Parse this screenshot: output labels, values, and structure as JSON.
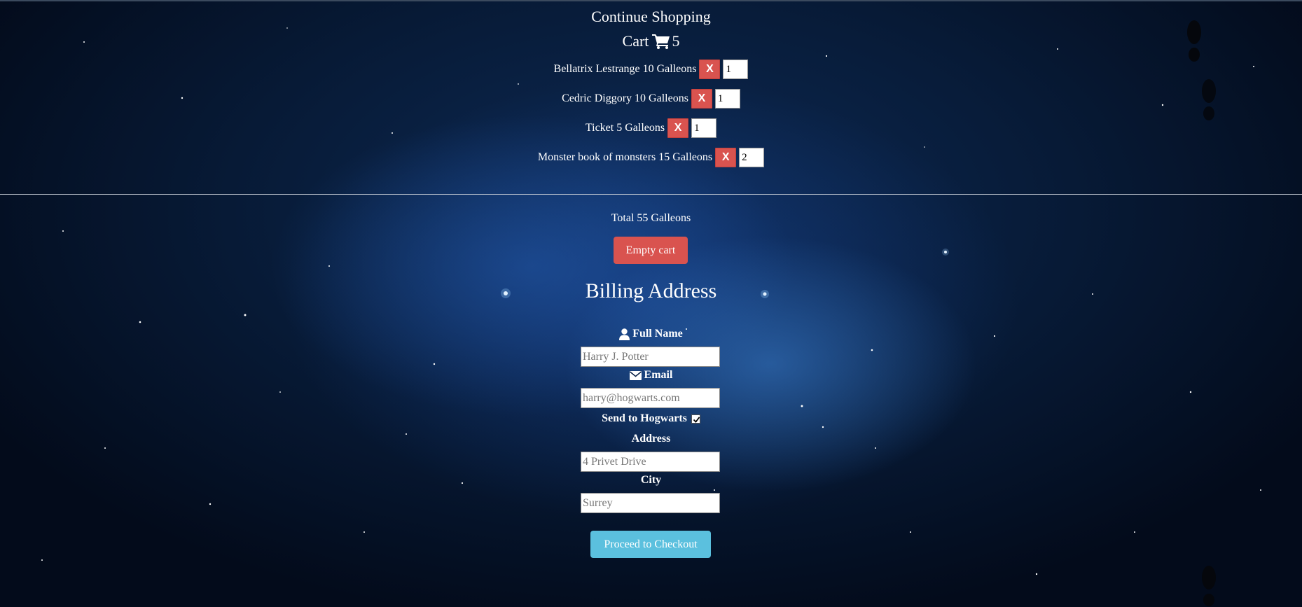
{
  "nav": {
    "continue_label": "Continue Shopping"
  },
  "cart": {
    "title": "Cart",
    "count": "5",
    "remove_label": "X",
    "items": [
      {
        "label": "Bellatrix Lestrange 10 Galleons",
        "qty": "1"
      },
      {
        "label": "Cedric Diggory 10 Galleons",
        "qty": "1"
      },
      {
        "label": "Ticket 5 Galleons",
        "qty": "1"
      },
      {
        "label": "Monster book of monsters 15 Galleons",
        "qty": "2"
      }
    ],
    "total": "Total 55 Galleons",
    "empty_label": "Empty cart"
  },
  "billing": {
    "title": "Billing Address",
    "full_name_label": "Full Name",
    "full_name_placeholder": "Harry J. Potter",
    "email_label": "Email",
    "email_placeholder": "harry@hogwarts.com",
    "hogwarts_label": "Send to Hogwarts",
    "hogwarts_checked": true,
    "address_label": "Address",
    "address_placeholder": "4 Privet Drive",
    "city_label": "City",
    "city_placeholder": "Surrey",
    "checkout_label": "Proceed to Checkout"
  },
  "icons": {
    "cart": "shopping-cart-icon",
    "user": "user-icon",
    "email": "envelope-icon",
    "checkbox": "checkbox-checked-icon"
  },
  "colors": {
    "danger": "#d9534f",
    "info": "#5bc0de",
    "text": "#ffffff"
  }
}
